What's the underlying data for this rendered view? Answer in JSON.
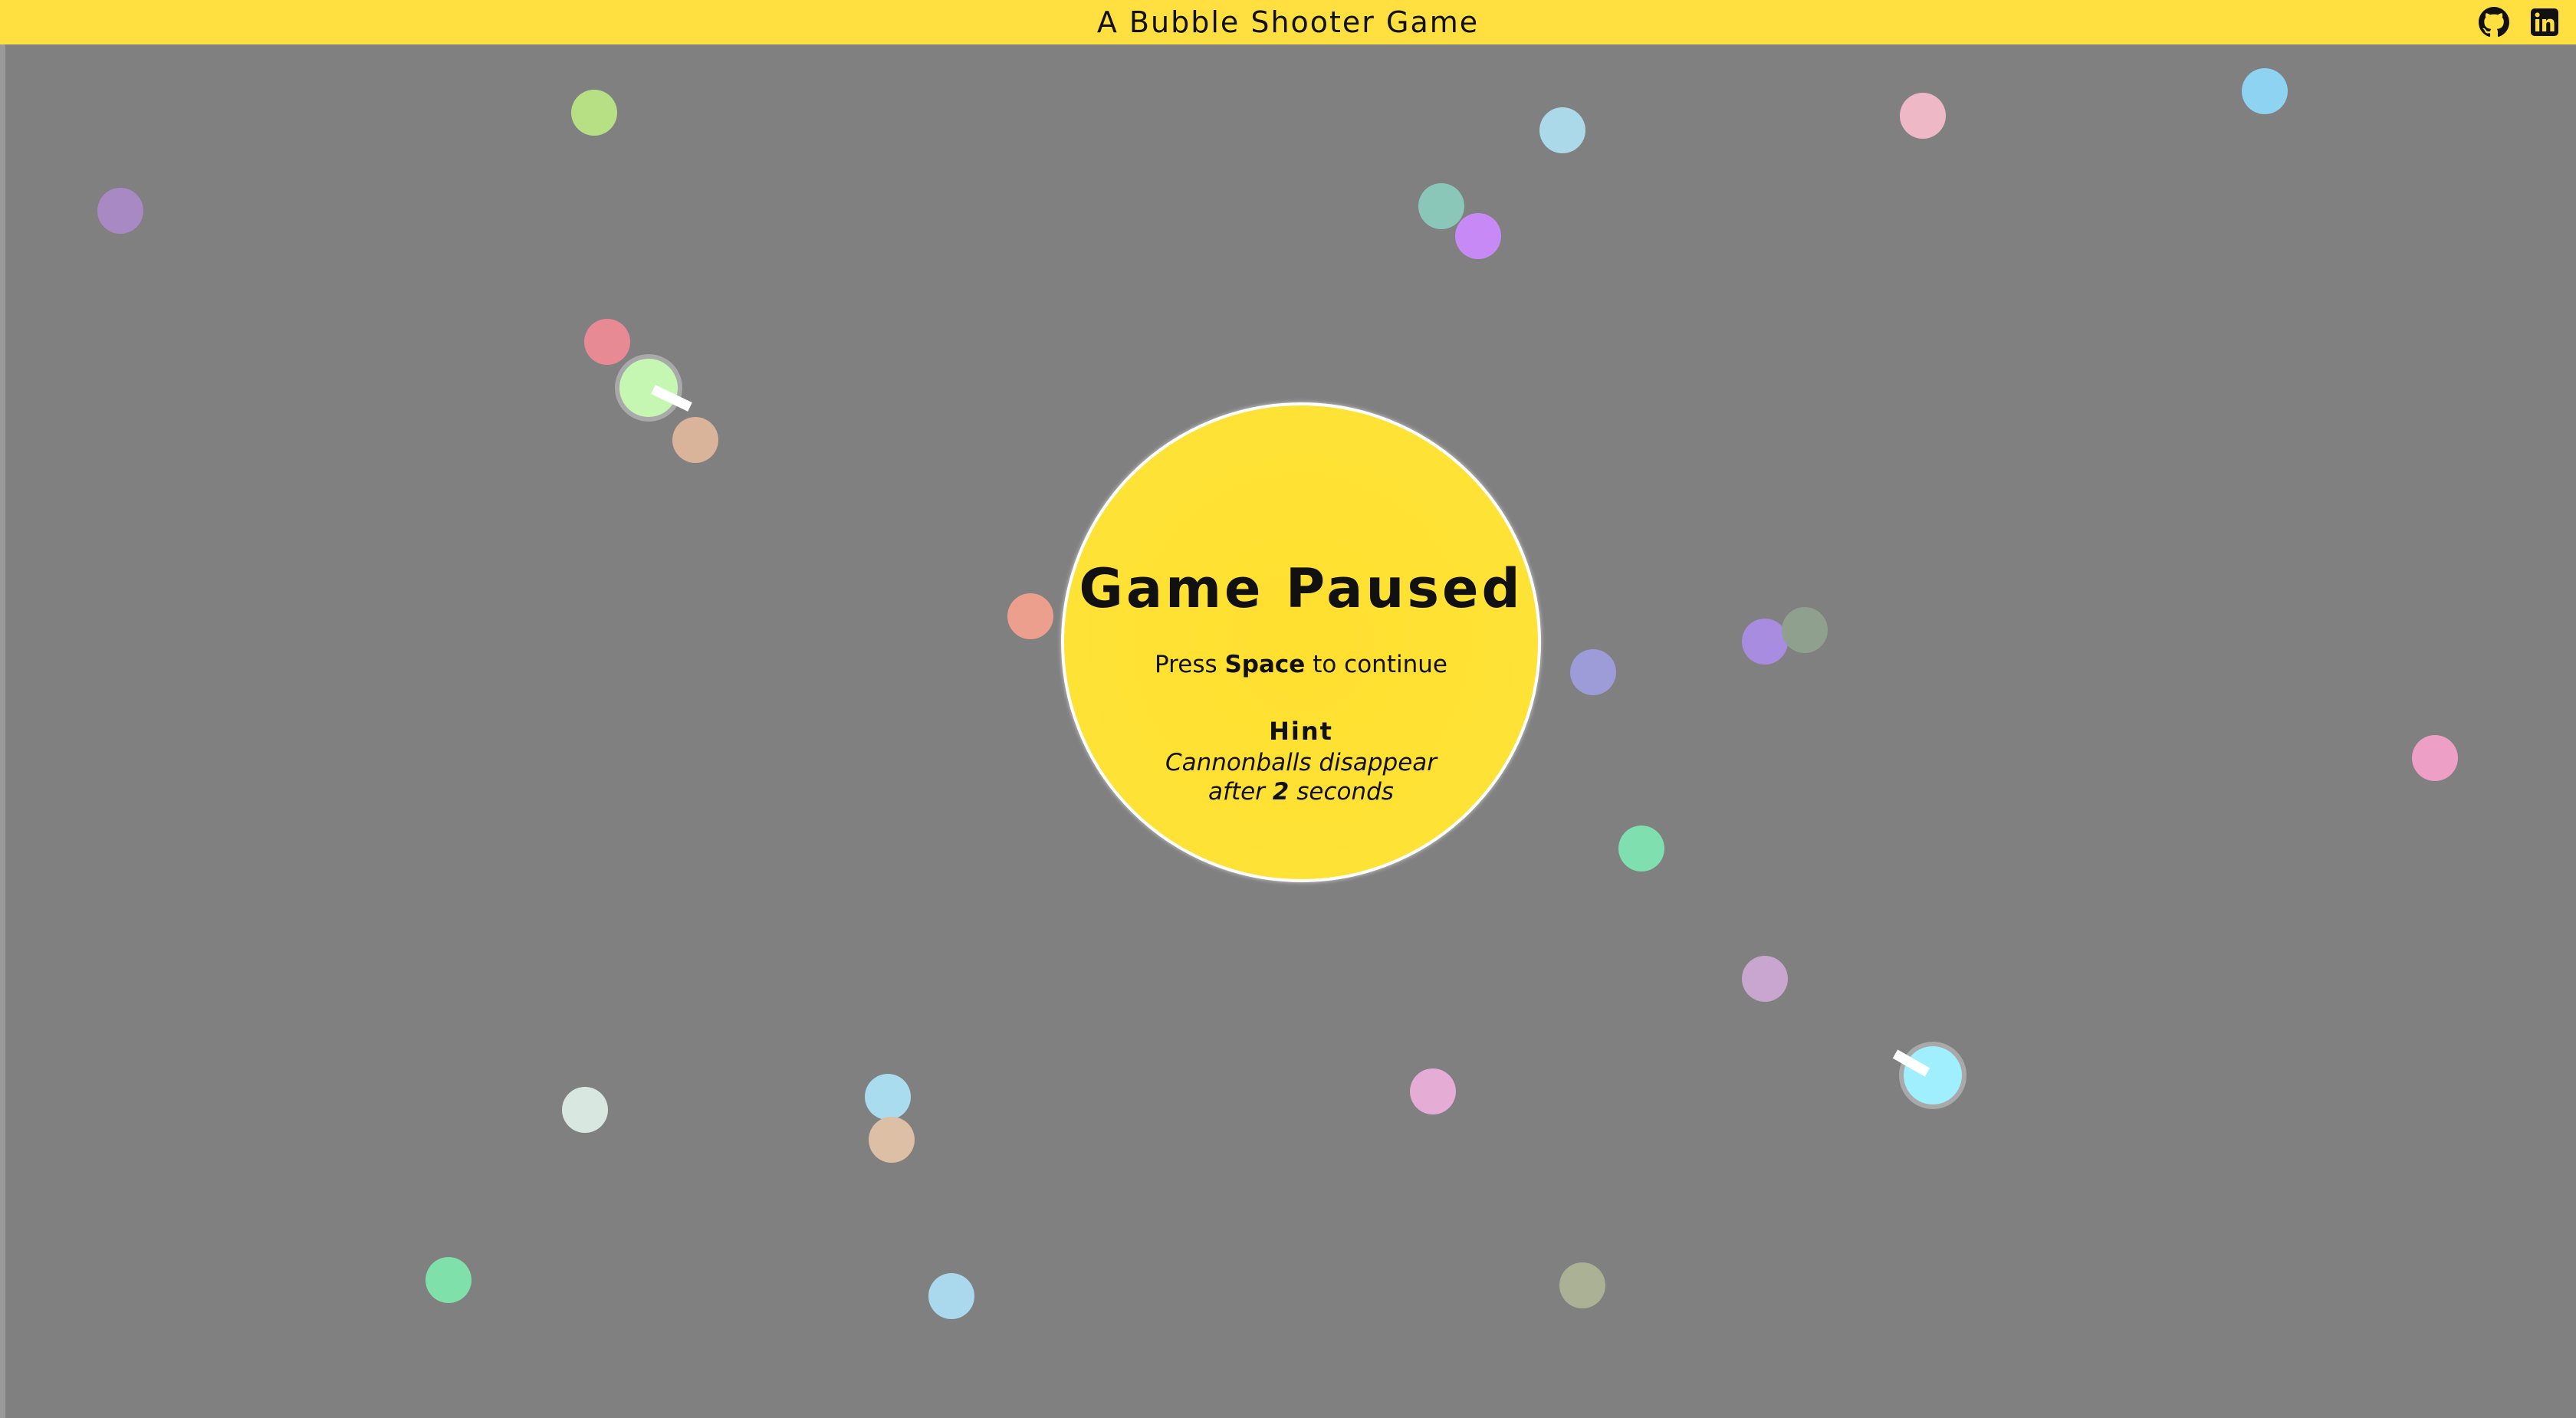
{
  "header": {
    "title": "A Bubble Shooter Game",
    "background_color": "#ffe040",
    "icons": [
      {
        "name": "github-icon"
      },
      {
        "name": "linkedin-icon"
      }
    ]
  },
  "game": {
    "background_color": "#808080",
    "state": "paused",
    "bubbles": [
      {
        "color": "#a989c4"
      },
      {
        "color": "#b7e085"
      },
      {
        "color": "#e88a94"
      },
      {
        "color": "#d9b49b"
      },
      {
        "color": "#abd9ea"
      },
      {
        "color": "#8bc7b8"
      },
      {
        "color": "#c789f6"
      },
      {
        "color": "#eeb8c6"
      },
      {
        "color": "#8fd3f3"
      },
      {
        "color": "#ec9f8d"
      },
      {
        "color": "#9d9bd8"
      },
      {
        "color": "#a78ce0"
      },
      {
        "color": "#8fa08f"
      },
      {
        "color": "#ed9fc5"
      },
      {
        "color": "#7fdfae"
      },
      {
        "color": "#c9a6cf"
      },
      {
        "color": "#d8e8e0"
      },
      {
        "color": "#a9dcee"
      },
      {
        "color": "#dcbfa4"
      },
      {
        "color": "#e5acd6"
      },
      {
        "color": "#7fe0a9"
      },
      {
        "color": "#aad8ec"
      },
      {
        "color": "#aab195"
      }
    ],
    "players": [
      {
        "color": "#c6f7b2"
      },
      {
        "color": "#9fefff"
      }
    ]
  },
  "pause_overlay": {
    "title": "Game Paused",
    "instruction_prefix": "Press",
    "instruction_key": "Space",
    "instruction_suffix": "to continue",
    "hint_heading": "Hint",
    "hint_line1": "Cannonballs disappear",
    "hint_line2_prefix": "after",
    "hint_line2_value": "2",
    "hint_line2_suffix": "seconds",
    "color": "#ffe236"
  }
}
